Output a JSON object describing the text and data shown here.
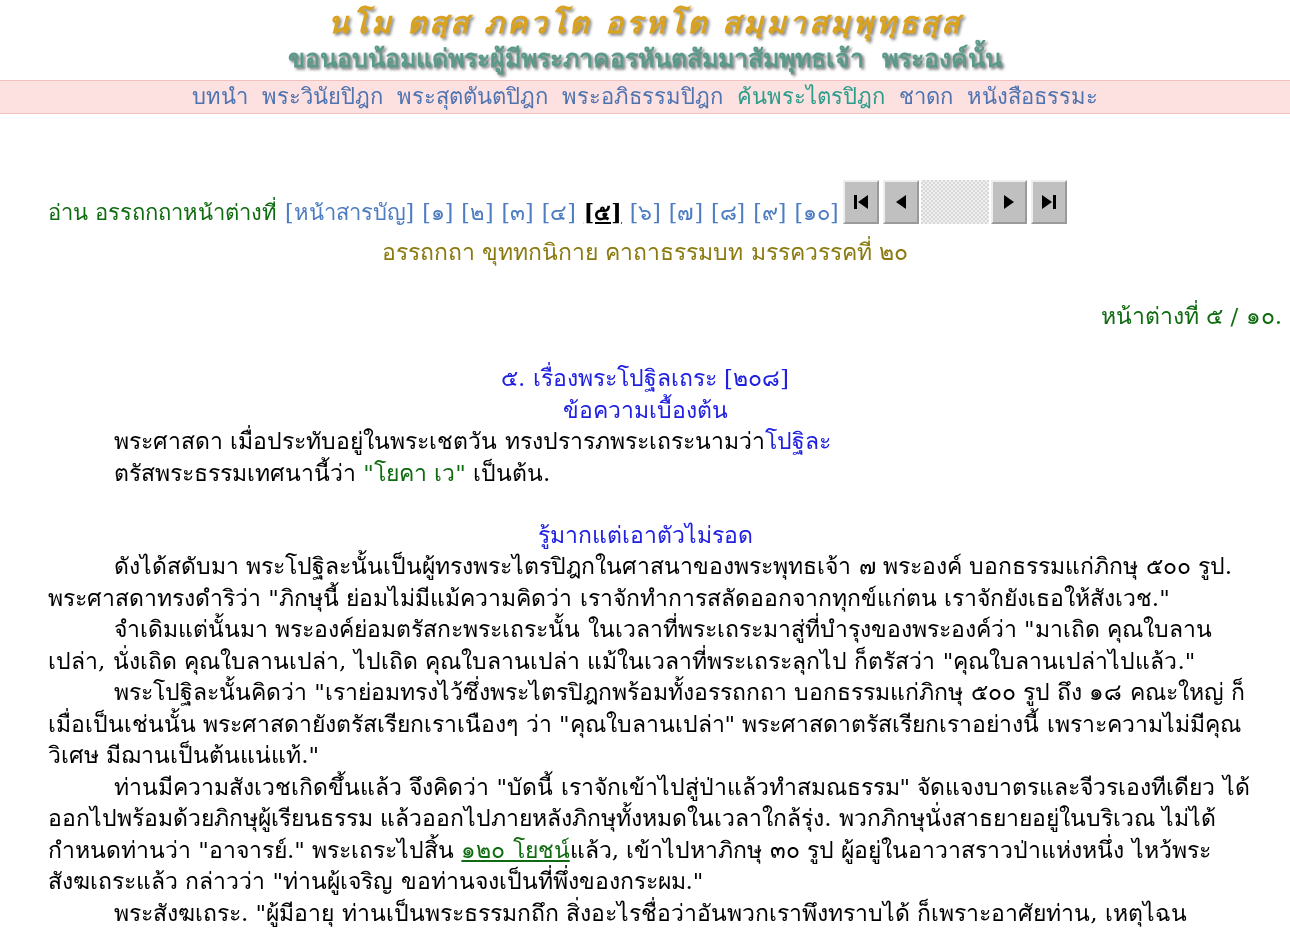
{
  "header": {
    "title": "นโม ตสฺส ภควโต อรหโต สมฺมาสมฺพุทฺธสฺส",
    "subtitle": "ขอนอบน้อมแด่พระผู้มีพระภาคอรหันตสัมมาสัมพุทธเจ้า  พระองค์นั้น"
  },
  "nav": [
    {
      "label": "บทนำ",
      "selected": false
    },
    {
      "label": "พระวินัยปิฎก",
      "selected": false
    },
    {
      "label": "พระสุตตันตปิฎก",
      "selected": false
    },
    {
      "label": "พระอภิธรรมปิฎก",
      "selected": false
    },
    {
      "label": "ค้นพระไตรปิฎก",
      "selected": true
    },
    {
      "label": "ชาดก",
      "selected": false
    },
    {
      "label": "หนังสือธรรมะ",
      "selected": false
    }
  ],
  "pager": {
    "prefix": "อ่าน อรรถกถาหน้าต่างที่",
    "pages": [
      {
        "label": "[หน้าสารบัญ]",
        "selected": false
      },
      {
        "label": "[๑]",
        "selected": false
      },
      {
        "label": "[๒]",
        "selected": false
      },
      {
        "label": "[๓]",
        "selected": false
      },
      {
        "label": "[๔]",
        "selected": false
      },
      {
        "label": "[๕]",
        "selected": true
      },
      {
        "label": "[๖]",
        "selected": false
      },
      {
        "label": "[๗]",
        "selected": false
      },
      {
        "label": "[๘]",
        "selected": false
      },
      {
        "label": "[๙]",
        "selected": false
      },
      {
        "label": "[๑๐]",
        "selected": false
      }
    ],
    "buttons": [
      {
        "kind": "first"
      },
      {
        "kind": "prev"
      },
      {
        "kind": "spacer"
      },
      {
        "kind": "next"
      },
      {
        "kind": "last"
      }
    ]
  },
  "book_title": "อรรถกถา ขุททกนิกาย คาถาธรรมบท มรรควรรคที่ ๒๐",
  "page_indicator": "หน้าต่างที่ ๕ / ๑๐.",
  "story_title": "๕. เรื่องพระโปฐิลเถระ [๒๐๘]",
  "sections": [
    {
      "heading": "ข้อความเบื้องต้น",
      "paragraphs": [
        [
          {
            "kind": "plain",
            "text": "พระศาสดา เมื่อประทับอยู่ในพระเชตวัน ทรงปรารภพระเถระนามว่า"
          },
          {
            "kind": "name",
            "text": "โปฐิละ"
          },
          {
            "kind": "plain",
            "text": "\nตรัสพระธรรมเทศนานี้ว่า "
          },
          {
            "kind": "quote",
            "text": "\"โยคา เว\""
          },
          {
            "kind": "plain",
            "text": " เป็นต้น."
          }
        ]
      ]
    },
    {
      "heading": "รู้มากแต่เอาตัวไม่รอด",
      "paragraphs": [
        [
          {
            "kind": "plain",
            "text": "ดังได้สดับมา พระโปฐิละนั้นเป็นผู้ทรงพระไตรปิฎกในศาสนาของพระพุทธเจ้า ๗ พระองค์ บอกธรรมแก่ภิกษุ ๕๐๐ รูป. พระศาสดาทรงดำริว่า \"ภิกษุนี้ ย่อมไม่มีแม้ความคิดว่า เราจักทำการสลัดออกจากทุกข์แก่ตน เราจักยังเธอให้สังเวช.\""
          }
        ],
        [
          {
            "kind": "plain",
            "text": "จำเดิมแต่นั้นมา พระองค์ย่อมตรัสกะพระเถระนั้น ในเวลาที่พระเถระมาสู่ที่บำรุงของพระองค์ว่า \"มาเถิด คุณใบลานเปล่า, นั่งเถิด คุณใบลานเปล่า, ไปเถิด คุณใบลานเปล่า แม้ในเวลาที่พระเถระลุกไป ก็ตรัสว่า \"คุณใบลานเปล่าไปแล้ว.\""
          }
        ],
        [
          {
            "kind": "plain",
            "text": "พระโปฐิละนั้นคิดว่า \"เราย่อมทรงไว้ซึ่งพระไตรปิฎกพร้อมทั้งอรรถกถา บอกธรรมแก่ภิกษุ ๕๐๐ รูป ถึง ๑๘ คณะใหญ่ ก็เมื่อเป็นเช่นนั้น พระศาสดายังตรัสเรียกเราเนืองๆ ว่า \"คุณใบลานเปล่า\" พระศาสดาตรัสเรียกเราอย่างนี้ เพราะความไม่มีคุณวิเศษ มีฌานเป็นต้นแน่แท้.\""
          }
        ],
        [
          {
            "kind": "plain",
            "text": "ท่านมีความสังเวชเกิดขึ้นแล้ว จึงคิดว่า \"บัดนี้ เราจักเข้าไปสู่ป่าแล้วทำสมณธรรม\" จัดแจงบาตรและจีวรเองทีเดียว ได้ออกไปพร้อมด้วยภิกษุผู้เรียนธรรม แล้วออกไปภายหลังภิกษุทั้งหมดในเวลาใกล้รุ่ง. พวกภิกษุนั่งสาธยายอยู่ในบริเวณ ไม่ได้กำหนดท่านว่า \"อาจารย์.\" พระเถระไปสิ้น "
          },
          {
            "kind": "link",
            "text": "๑๒๐ โยชน์"
          },
          {
            "kind": "plain",
            "text": "แล้ว, เข้าไปหาภิกษุ ๓๐ รูป ผู้อยู่ในอาวาสราวป่าแห่งหนึ่ง ไหว้พระสังฆเถระแล้ว กล่าวว่า \"ท่านผู้เจริญ ขอท่านจงเป็นที่พึ่งของกระผม.\""
          }
        ],
        [
          {
            "kind": "plain",
            "text": "พระสังฆเถระ. \"ผู้มีอายุ ท่านเป็นพระธรรมกถึก สิ่งอะไรชื่อว่าอันพวกเราพึงทราบได้ ก็เพราะอาศัยท่าน, เหตุไฉน"
          }
        ]
      ]
    }
  ]
}
